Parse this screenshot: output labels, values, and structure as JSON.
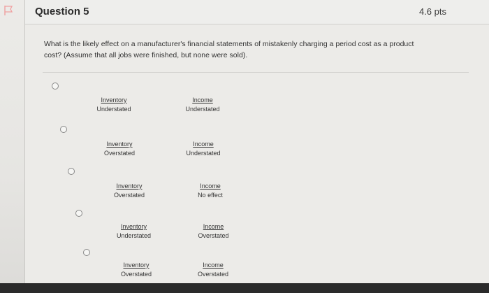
{
  "question": {
    "title": "Question 5",
    "points": "4.6 pts",
    "text": "What is the likely effect on a manufacturer's financial statements of mistakenly charging a period cost as a product cost? (Assume that all jobs were finished, but none were sold)."
  },
  "answers": [
    {
      "inventory_label": "Inventory",
      "inventory_value": "Understated",
      "income_label": "Income",
      "income_value": "Understated"
    },
    {
      "inventory_label": "Inventory",
      "inventory_value": "Overstated",
      "income_label": "Income",
      "income_value": "Understated"
    },
    {
      "inventory_label": "Inventory",
      "inventory_value": "Overstated",
      "income_label": "Income",
      "income_value": "No effect"
    },
    {
      "inventory_label": "Inventory",
      "inventory_value": "Understated",
      "income_label": "Income",
      "income_value": "Overstated"
    },
    {
      "inventory_label": "Inventory",
      "inventory_value": "Overstated",
      "income_label": "Income",
      "income_value": "Overstated"
    }
  ],
  "icons": {
    "flag": "flag-icon",
    "radio": "radio-button"
  }
}
